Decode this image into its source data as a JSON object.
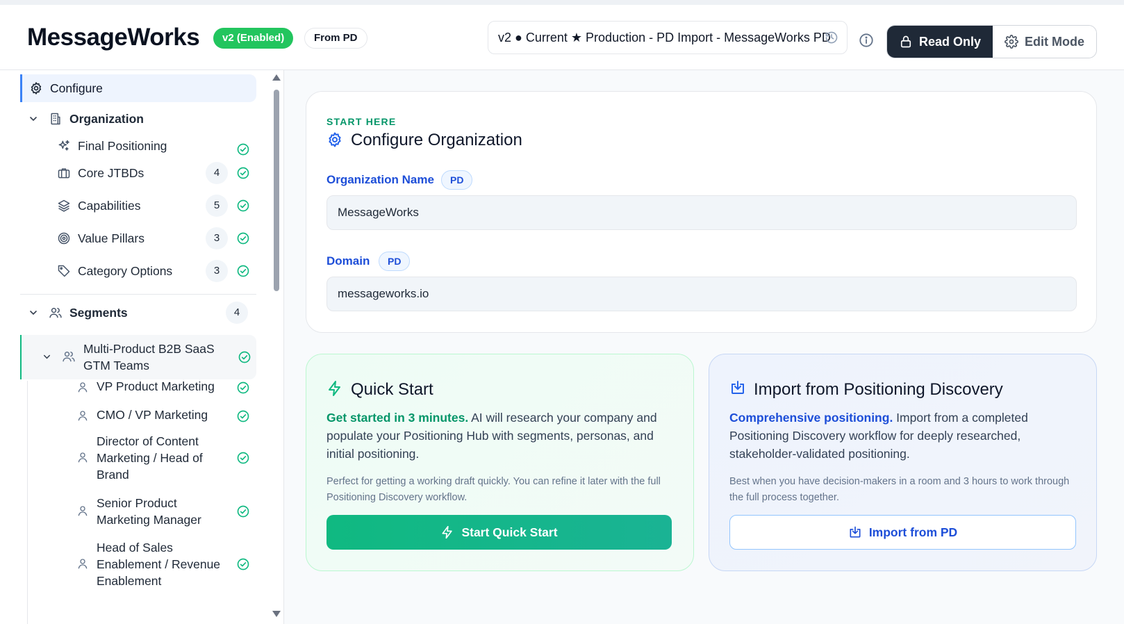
{
  "header": {
    "app_title": "MessageWorks",
    "version_badge": "v2 (Enabled)",
    "source_badge": "From PD",
    "version_selector": "v2 ● Current ★ Production - PD Import - MessageWorks PD",
    "mode_read_only": "Read Only",
    "mode_edit": "Edit Mode"
  },
  "sidebar": {
    "configure": "Configure",
    "organization": "Organization",
    "org_items": [
      {
        "label": "Final Positioning",
        "count": null
      },
      {
        "label": "Core JTBDs",
        "count": "4"
      },
      {
        "label": "Capabilities",
        "count": "5"
      },
      {
        "label": "Value Pillars",
        "count": "3"
      },
      {
        "label": "Category Options",
        "count": "3"
      }
    ],
    "segments": {
      "label": "Segments",
      "count": "4"
    },
    "segment_group": {
      "label_line1": "Multi-Product B2B SaaS",
      "label_line2": "GTM Teams"
    },
    "personas": [
      {
        "lines": [
          "VP Product Marketing"
        ]
      },
      {
        "lines": [
          "CMO / VP Marketing"
        ]
      },
      {
        "lines": [
          "Director of Content",
          "Marketing / Head of",
          "Brand"
        ]
      },
      {
        "lines": [
          "Senior Product",
          "Marketing Manager"
        ]
      },
      {
        "lines": [
          "Head of Sales",
          "Enablement / Revenue",
          "Enablement"
        ]
      }
    ]
  },
  "configure_card": {
    "eyebrow": "START HERE",
    "title": "Configure Organization",
    "org_name_label": "Organization Name",
    "org_name_badge": "PD",
    "org_name_value": "MessageWorks",
    "domain_label": "Domain",
    "domain_badge": "PD",
    "domain_value": "messageworks.io"
  },
  "quick_start": {
    "title": "Quick Start",
    "lead_bold": "Get started in 3 minutes.",
    "lead_rest": " AI will research your company and populate your Positioning Hub with segments, personas, and initial positioning.",
    "note": "Perfect for getting a working draft quickly. You can refine it later with the full Positioning Discovery workflow.",
    "button": "Start Quick Start"
  },
  "import_pd": {
    "title": "Import from Positioning Discovery",
    "lead_bold": "Comprehensive positioning.",
    "lead_rest": " Import from a completed Positioning Discovery workflow for deeply researched, stakeholder-validated positioning.",
    "note": "Best when you have decision-makers in a room and 3 hours to work through the full process together.",
    "button": "Import from PD"
  },
  "colors": {
    "accent_green": "#10b981",
    "accent_blue": "#1d4ed8",
    "dark": "#1f2937"
  }
}
